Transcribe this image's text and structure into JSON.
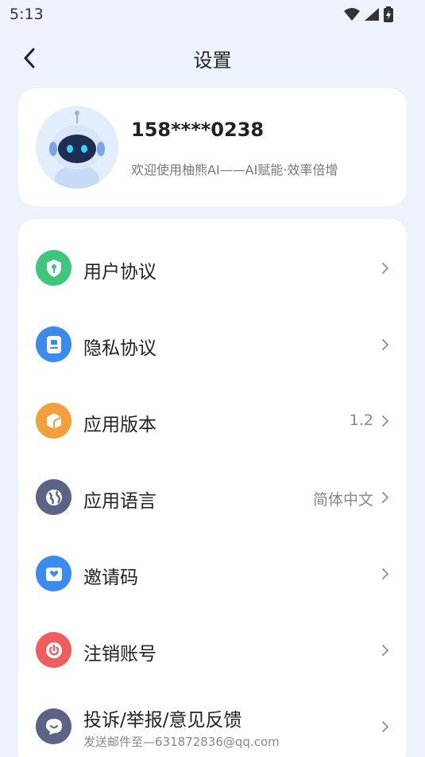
{
  "status": {
    "time": "5:13"
  },
  "header": {
    "title": "设置"
  },
  "profile": {
    "phone": "158****0238",
    "welcome": "欢迎使用柚熊AI——AI赋能·效率倍增"
  },
  "menu": {
    "items": [
      {
        "label": "用户协议",
        "value": "",
        "icon": "shield-icon",
        "color": "#3ec77a"
      },
      {
        "label": "隐私协议",
        "value": "",
        "icon": "document-icon",
        "color": "#3b8af0"
      },
      {
        "label": "应用版本",
        "value": "1.2",
        "icon": "cube-icon",
        "color": "#f3a03c"
      },
      {
        "label": "应用语言",
        "value": "简体中文",
        "icon": "globe-icon",
        "color": "#5b6486"
      },
      {
        "label": "邀请码",
        "value": "",
        "icon": "envelope-heart-icon",
        "color": "#3b8af0"
      },
      {
        "label": "注销账号",
        "value": "",
        "icon": "power-icon",
        "color": "#ef5e5e"
      },
      {
        "label": "投诉/举报/意见反馈",
        "sub": "发送邮件至—631872836@qq.com",
        "icon": "chat-bubble-icon",
        "color": "#5b6486"
      }
    ]
  }
}
